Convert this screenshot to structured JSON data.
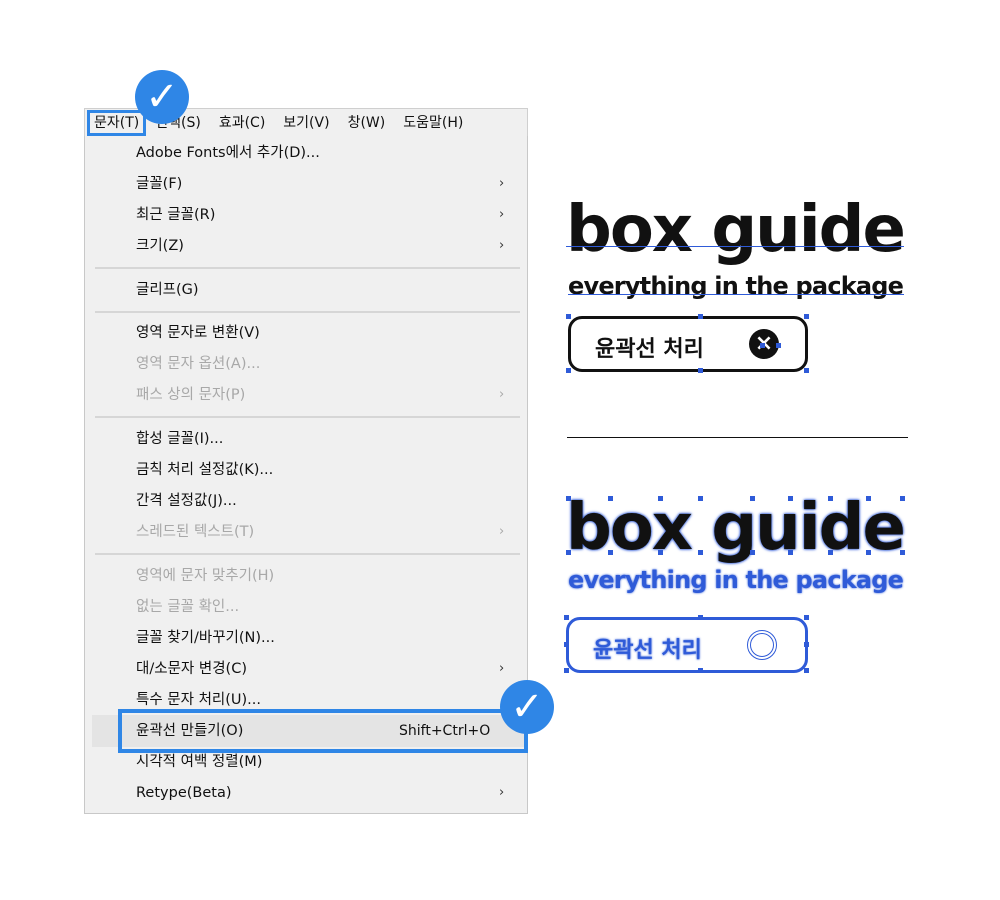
{
  "menubar": {
    "items": [
      "문자(T)",
      "선택(S)",
      "효과(C)",
      "보기(V)",
      "창(W)",
      "도움말(H)"
    ]
  },
  "menu": {
    "items": [
      {
        "label": "Adobe Fonts에서 추가(D)...",
        "arrow": "",
        "shortcut": "",
        "disabled": false
      },
      {
        "label": "글꼴(F)",
        "arrow": "›",
        "shortcut": "",
        "disabled": false
      },
      {
        "label": "최근 글꼴(R)",
        "arrow": "›",
        "shortcut": "",
        "disabled": false
      },
      {
        "label": "크기(Z)",
        "arrow": "›",
        "shortcut": "",
        "disabled": false
      },
      {
        "label": "글리프(G)",
        "arrow": "",
        "shortcut": "",
        "disabled": false
      },
      {
        "label": "영역 문자로 변환(V)",
        "arrow": "",
        "shortcut": "",
        "disabled": false
      },
      {
        "label": "영역 문자 옵션(A)...",
        "arrow": "",
        "shortcut": "",
        "disabled": true
      },
      {
        "label": "패스 상의 문자(P)",
        "arrow": "›",
        "shortcut": "",
        "disabled": true
      },
      {
        "label": "합성 글꼴(I)...",
        "arrow": "",
        "shortcut": "",
        "disabled": false
      },
      {
        "label": "금칙 처리 설정값(K)...",
        "arrow": "",
        "shortcut": "",
        "disabled": false
      },
      {
        "label": "간격 설정값(J)...",
        "arrow": "",
        "shortcut": "",
        "disabled": false
      },
      {
        "label": "스레드된 텍스트(T)",
        "arrow": "›",
        "shortcut": "",
        "disabled": true
      },
      {
        "label": "영역에 문자 맞추기(H)",
        "arrow": "",
        "shortcut": "",
        "disabled": true
      },
      {
        "label": "없는 글꼴 확인...",
        "arrow": "",
        "shortcut": "",
        "disabled": true
      },
      {
        "label": "글꼴 찾기/바꾸기(N)...",
        "arrow": "",
        "shortcut": "",
        "disabled": false
      },
      {
        "label": "대/소문자 변경(C)",
        "arrow": "›",
        "shortcut": "",
        "disabled": false
      },
      {
        "label": "특수 문자 처리(U)...",
        "arrow": "",
        "shortcut": "",
        "disabled": false
      },
      {
        "label": "윤곽선 만들기(O)",
        "arrow": "",
        "shortcut": "Shift+Ctrl+O",
        "disabled": false
      },
      {
        "label": "시각적 여백 정렬(M)",
        "arrow": "",
        "shortcut": "",
        "disabled": false
      },
      {
        "label": "Retype(Beta)",
        "arrow": "›",
        "shortcut": "",
        "disabled": false
      }
    ]
  },
  "check_glyph": "✓",
  "artwork": {
    "title": "box guide",
    "subtitle": "everything in the package",
    "pill_text": "윤곽선 처리",
    "pill_icon": "×",
    "accent_color": "#2f86e6",
    "outline_color": "#2f5bd8"
  }
}
